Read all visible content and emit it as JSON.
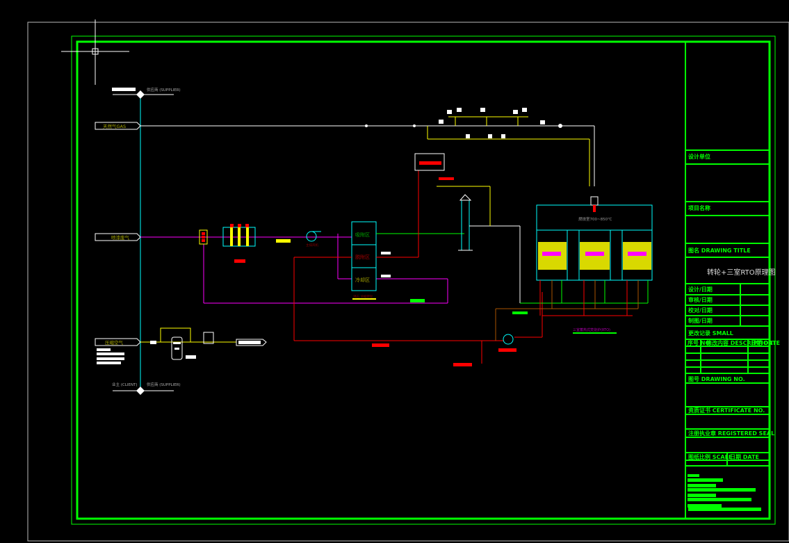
{
  "colors": {
    "frame": "#00ff00",
    "gas": "#ffff00",
    "exhaust": "#ff00ff",
    "hot": "#ff0000",
    "air": "#00ffff",
    "clean": "#00ff00",
    "brick": "#ffff00"
  },
  "supply": {
    "supplier_top": "供应商 (SUPPLIER)",
    "supplier_bottom": "供应商 (SUPPLIER)",
    "client": "业主 (CLIENT)"
  },
  "inlets": {
    "gas": "天然气GAS",
    "paint_exhaust": "喷漆废气",
    "compressed_air": "压缩空气"
  },
  "rotor": {
    "adsorption": "吸附区",
    "desorption": "脱附区",
    "cooling": "冷却区",
    "caption": "沸石 浓缩转轮"
  },
  "fan": {
    "main_fan": "主排风机"
  },
  "rto": {
    "chamber": "燃烧室700~850℃",
    "caption": "三室蓄热式焚烧炉(RTO)"
  },
  "title_block": {
    "design_unit": "设计单位",
    "project_name": "项目名称",
    "drawing_title_label": "图名 DRAWING TITLE",
    "drawing_title": "转轮+三室RTO原理图",
    "rows": [
      "设计/日期",
      "审核/日期",
      "校对/日期",
      "制图/日期"
    ],
    "revision_label": "更改记录 SMALL",
    "rev_headers": [
      "序号 NO.",
      "修改内容 DESCRIPTION",
      "日期 DATE"
    ],
    "drawing_no": "图号 DRAWING NO.",
    "certificate": "资质证书 CERTIFICATE NO.",
    "seal": "注册执业章 REGISTERED SEAL",
    "scale": "图纸比例 SCALE",
    "date": "日期 DATE"
  }
}
